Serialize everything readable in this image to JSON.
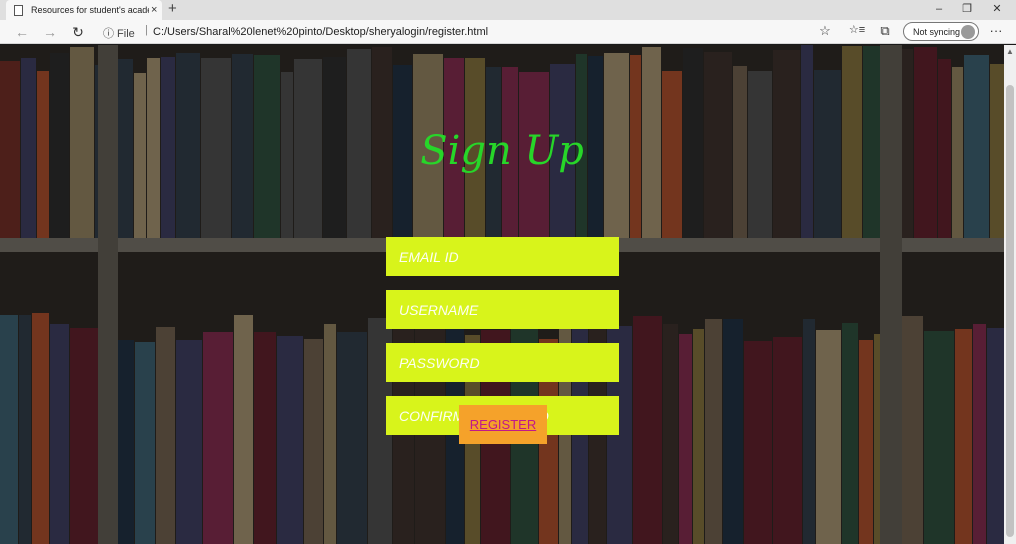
{
  "browser": {
    "tab_title": "Resources for student's academic",
    "tab_close": "×",
    "new_tab": "+",
    "window_minimize": "–",
    "window_restore": "❐",
    "window_close": "✕",
    "back": "←",
    "forward": "→",
    "refresh": "↻",
    "site_info": "ⓘ File",
    "separator": "|",
    "url": "C:/Users/Sharal%20lenet%20pinto/Desktop/sheryalogin/register.html",
    "favorite_icon": "☆",
    "favorites_icon": "☆≡",
    "collections_icon": "⧉",
    "sync_label": "Not syncing",
    "more_icon": "···"
  },
  "form": {
    "title": "Sign Up",
    "email_placeholder": "EMAIL ID",
    "username_placeholder": "USERNAME",
    "password_placeholder": "PASSWORD",
    "confirm_placeholder": "CONFIRM PASSWORD",
    "register_label": "REGISTER"
  },
  "colors": {
    "field_bg": "#d8f41b",
    "title": "#27d629",
    "button_bg": "#f5a22a",
    "button_text": "#c0188a"
  }
}
